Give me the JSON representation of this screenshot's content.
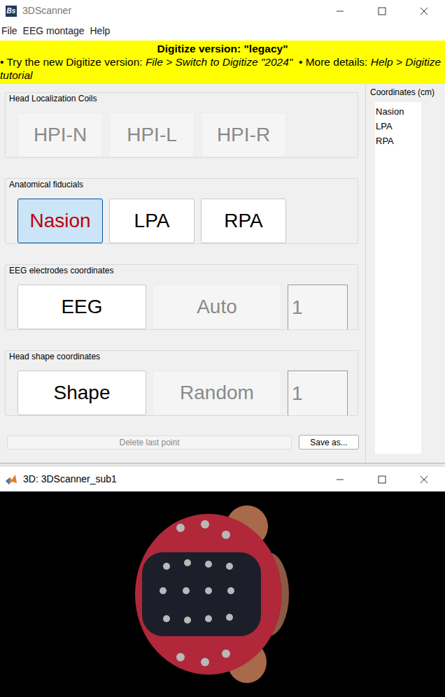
{
  "window": {
    "title": "3DScanner",
    "app_icon": "Bs"
  },
  "menu": [
    "File",
    "EEG montage",
    "Help"
  ],
  "banner": {
    "title": "Digitize version: \"legacy\"",
    "segments": [
      {
        "text": "• Try the new Digitize version: ",
        "italic": false
      },
      {
        "text": "File > Switch to Digitize \"2024\"",
        "italic": true
      },
      {
        "text": "  • More details: ",
        "italic": false
      },
      {
        "text": "Help > Digitize tutorial",
        "italic": true
      }
    ]
  },
  "groups": [
    {
      "title": "Head Localization Coils",
      "buttons": [
        {
          "label": "HPI-N",
          "disabled": true,
          "selected": false
        },
        {
          "label": "HPI-L",
          "disabled": true,
          "selected": false
        },
        {
          "label": "HPI-R",
          "disabled": true,
          "selected": false
        }
      ]
    },
    {
      "title": "Anatomical fiducials",
      "buttons": [
        {
          "label": "Nasion",
          "disabled": false,
          "selected": true
        },
        {
          "label": "LPA",
          "disabled": false,
          "selected": false
        },
        {
          "label": "RPA",
          "disabled": false,
          "selected": false
        }
      ]
    },
    {
      "title": "EEG electrodes coordinates",
      "buttons": [
        {
          "label": "EEG",
          "disabled": false,
          "selected": false
        },
        {
          "label": "Auto",
          "disabled": true,
          "selected": false
        }
      ],
      "field": "1"
    },
    {
      "title": "Head shape coordinates",
      "buttons": [
        {
          "label": "Shape",
          "disabled": false,
          "selected": false
        },
        {
          "label": "Random",
          "disabled": true,
          "selected": false
        }
      ],
      "field": "1"
    }
  ],
  "delete_button": {
    "label": "Delete last point",
    "disabled": true
  },
  "save_button": {
    "label": "Save as..."
  },
  "coordinates": {
    "title": "Coordinates (cm)",
    "items": [
      "Nasion",
      "LPA",
      "RPA"
    ]
  },
  "viewer": {
    "title": "3D: 3DScanner_sub1"
  }
}
